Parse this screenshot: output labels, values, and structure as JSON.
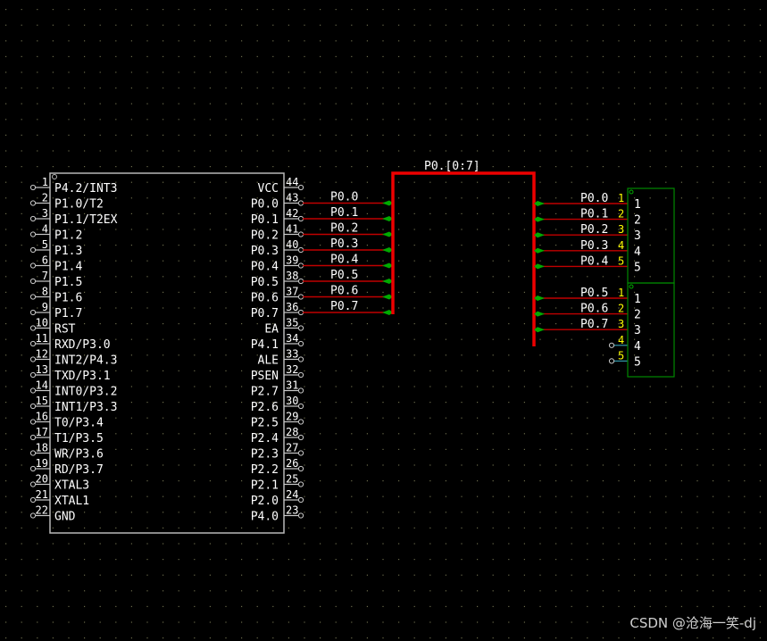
{
  "colors": {
    "background": "#000000",
    "grid_dot": "#6a6a4a",
    "chip_border": "#b8b8b8",
    "pin": "#c8c8c8",
    "wire": "#c00000",
    "bus": "#ee0000",
    "junction": "#00aa00",
    "connector_border": "#008800",
    "text": "#ffffff",
    "connector_pin_number": "#ffff00",
    "open_wire": "#3399aa"
  },
  "chip": {
    "left_pins": [
      {
        "num": "1",
        "label": "P4.2/INT3"
      },
      {
        "num": "2",
        "label": "P1.0/T2"
      },
      {
        "num": "3",
        "label": "P1.1/T2EX"
      },
      {
        "num": "4",
        "label": "P1.2"
      },
      {
        "num": "5",
        "label": "P1.3"
      },
      {
        "num": "6",
        "label": "P1.4"
      },
      {
        "num": "7",
        "label": "P1.5"
      },
      {
        "num": "8",
        "label": "P1.6"
      },
      {
        "num": "9",
        "label": "P1.7"
      },
      {
        "num": "10",
        "label": "RST"
      },
      {
        "num": "11",
        "label": "RXD/P3.0"
      },
      {
        "num": "12",
        "label": "INT2/P4.3"
      },
      {
        "num": "13",
        "label": "TXD/P3.1"
      },
      {
        "num": "14",
        "label": "INT0/P3.2"
      },
      {
        "num": "15",
        "label": "INT1/P3.3"
      },
      {
        "num": "16",
        "label": "T0/P3.4"
      },
      {
        "num": "17",
        "label": "T1/P3.5"
      },
      {
        "num": "18",
        "label": "WR/P3.6"
      },
      {
        "num": "19",
        "label": "RD/P3.7"
      },
      {
        "num": "20",
        "label": "XTAL3"
      },
      {
        "num": "21",
        "label": "XTAL1"
      },
      {
        "num": "22",
        "label": "GND"
      }
    ],
    "right_pins": [
      {
        "num": "44",
        "label": "VCC"
      },
      {
        "num": "43",
        "label": "P0.0"
      },
      {
        "num": "42",
        "label": "P0.1"
      },
      {
        "num": "41",
        "label": "P0.2"
      },
      {
        "num": "40",
        "label": "P0.3"
      },
      {
        "num": "39",
        "label": "P0.4"
      },
      {
        "num": "38",
        "label": "P0.5"
      },
      {
        "num": "37",
        "label": "P0.6"
      },
      {
        "num": "36",
        "label": "P0.7"
      },
      {
        "num": "35",
        "label": "EA"
      },
      {
        "num": "34",
        "label": "P4.1"
      },
      {
        "num": "33",
        "label": "ALE"
      },
      {
        "num": "32",
        "label": "PSEN"
      },
      {
        "num": "31",
        "label": "P2.7"
      },
      {
        "num": "30",
        "label": "P2.6"
      },
      {
        "num": "29",
        "label": "P2.5"
      },
      {
        "num": "28",
        "label": "P2.4"
      },
      {
        "num": "27",
        "label": "P2.3"
      },
      {
        "num": "26",
        "label": "P2.2"
      },
      {
        "num": "25",
        "label": "P2.1"
      },
      {
        "num": "24",
        "label": "P2.0"
      },
      {
        "num": "23",
        "label": "P4.0"
      }
    ]
  },
  "left_wires": [
    "P0.0",
    "P0.1",
    "P0.2",
    "P0.3",
    "P0.4",
    "P0.5",
    "P0.6",
    "P0.7"
  ],
  "bus": {
    "label": "P0.[0:7]"
  },
  "connector1": {
    "pins": [
      {
        "num": "1",
        "inner": "1",
        "net": "P0.0"
      },
      {
        "num": "2",
        "inner": "2",
        "net": "P0.1"
      },
      {
        "num": "3",
        "inner": "3",
        "net": "P0.2"
      },
      {
        "num": "4",
        "inner": "4",
        "net": "P0.3"
      },
      {
        "num": "5",
        "inner": "5",
        "net": "P0.4"
      }
    ]
  },
  "connector2": {
    "pins": [
      {
        "num": "1",
        "inner": "1",
        "net": "P0.5"
      },
      {
        "num": "2",
        "inner": "2",
        "net": "P0.6"
      },
      {
        "num": "3",
        "inner": "3",
        "net": "P0.7"
      },
      {
        "num": "4",
        "inner": "4",
        "net": ""
      },
      {
        "num": "5",
        "inner": "5",
        "net": ""
      }
    ]
  },
  "watermark": "CSDN @沧海一笑-dj"
}
